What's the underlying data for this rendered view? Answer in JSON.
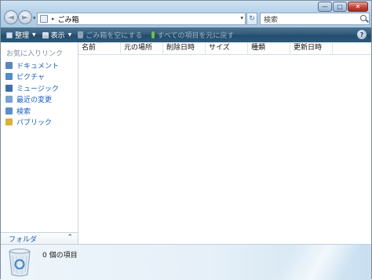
{
  "window": {
    "caption_buttons": {
      "minimize": "—",
      "maximize": "□",
      "close": "✕"
    }
  },
  "navigation": {
    "back_glyph": "◄",
    "forward_glyph": "►",
    "dropdown_glyph": "▾"
  },
  "address_bar": {
    "separator": "▸",
    "location": "ごみ箱",
    "dropdown_glyph": "▾",
    "refresh_glyph": "↻"
  },
  "search": {
    "placeholder": "検索"
  },
  "toolbar": {
    "organize_label": "整理",
    "views_label": "表示",
    "empty_bin_label": "ごみ箱を空にする",
    "restore_all_label": "すべての項目を元に戻す",
    "dropdown_glyph": "▼",
    "help_glyph": "?"
  },
  "sidebar": {
    "favorites_title": "お気に入りリンク",
    "items": [
      {
        "label": "ドキュメント",
        "icon": "documents-icon",
        "color": "#5b86b8"
      },
      {
        "label": "ピクチャ",
        "icon": "pictures-icon",
        "color": "#4f8cc9"
      },
      {
        "label": "ミュージック",
        "icon": "music-icon",
        "color": "#3f6fa8"
      },
      {
        "label": "最近の変更",
        "icon": "recent-changes-icon",
        "color": "#7aa3cf"
      },
      {
        "label": "検索",
        "icon": "search-folder-icon",
        "color": "#5c8fc4"
      },
      {
        "label": "パブリック",
        "icon": "public-folder-icon",
        "color": "#d9b23a"
      }
    ],
    "folders_label": "フォルダ",
    "folders_chevron": "⌃"
  },
  "file_list": {
    "sort_indicator": "^",
    "columns": [
      "名前",
      "元の場所",
      "削除日時",
      "サイズ",
      "種類",
      "更新日時"
    ]
  },
  "details_pane": {
    "item_count_text": "0 個の項目"
  },
  "colors": {
    "toolbar": "#2f5878",
    "link": "#1c5fb7",
    "close_button": "#c2453a"
  }
}
